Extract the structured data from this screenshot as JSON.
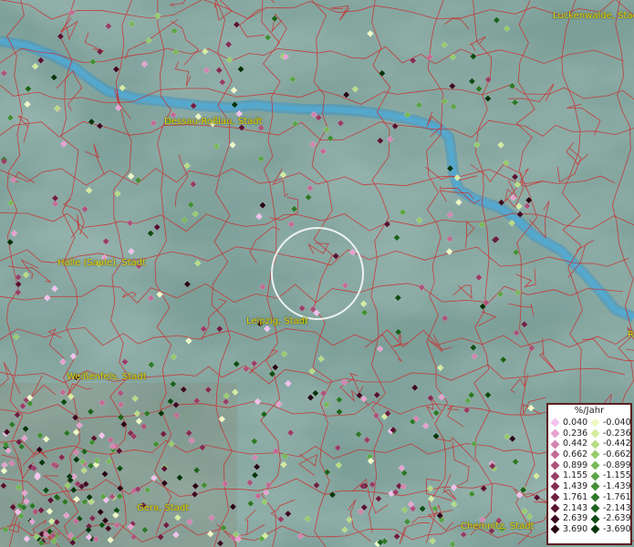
{
  "cities": [
    {
      "name": "Luckenwalde, Stadt",
      "key": "luckenwalde"
    },
    {
      "name": "Dessau-Roßlau, Stadt",
      "key": "dessau"
    },
    {
      "name": "Halle (Saale), Stadt",
      "key": "halle"
    },
    {
      "name": "Leipzig, Stadt",
      "key": "leipzig"
    },
    {
      "name": "Weißenfels, Stadt",
      "key": "weissenfels"
    },
    {
      "name": "Gera, Stadt",
      "key": "gera"
    },
    {
      "name": "Chemnitz, Stadt",
      "key": "chemnitz"
    },
    {
      "name": "R",
      "key": "edge"
    }
  ],
  "legend": {
    "title": "%/Jahr",
    "positive": [
      {
        "label": "0.040",
        "color": "#f4c0ee"
      },
      {
        "label": "0.236",
        "color": "#e6a2cf"
      },
      {
        "label": "0.442",
        "color": "#d484b0"
      },
      {
        "label": "0.662",
        "color": "#c26a94"
      },
      {
        "label": "0.899",
        "color": "#ac527a"
      },
      {
        "label": "1.155",
        "color": "#983e66"
      },
      {
        "label": "1.439",
        "color": "#832c52"
      },
      {
        "label": "1.761",
        "color": "#6e1e40"
      },
      {
        "label": "2.143",
        "color": "#561230"
      },
      {
        "label": "2.639",
        "color": "#3e0a22"
      },
      {
        "label": "3.690",
        "color": "#280414"
      }
    ],
    "negative": [
      {
        "label": "-0.040",
        "color": "#eef8c4"
      },
      {
        "label": "-0.236",
        "color": "#d4ec9e"
      },
      {
        "label": "-0.442",
        "color": "#b6dc84"
      },
      {
        "label": "-0.662",
        "color": "#96cc6c"
      },
      {
        "label": "-0.899",
        "color": "#78b858"
      },
      {
        "label": "-1.155",
        "color": "#5ca446"
      },
      {
        "label": "-1.439",
        "color": "#438e36"
      },
      {
        "label": "-1.761",
        "color": "#2e7828"
      },
      {
        "label": "-2.143",
        "color": "#1c621c"
      },
      {
        "label": "-2.639",
        "color": "#0e4c12"
      },
      {
        "label": "-3.690",
        "color": "#04340a"
      }
    ]
  },
  "colors": {
    "river": "#3f98c6",
    "boundary": "#cc2a2a",
    "label": "#e8d400",
    "selection_ring": "#ffffff"
  }
}
